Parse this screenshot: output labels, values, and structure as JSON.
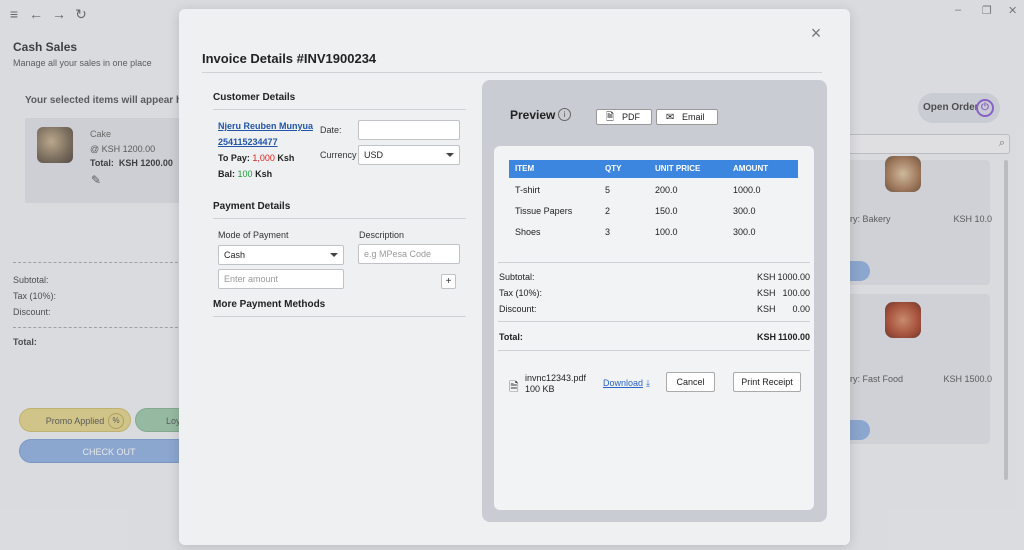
{
  "background": {
    "page_title": "Cash Sales",
    "page_subtitle": "Manage all your sales in one place",
    "selected_hint": "Your selected items will appear her",
    "cart_item": {
      "name": "Cake",
      "price": "@ KSH 1200.00",
      "total_label": "Total:",
      "total_value": "KSH 1200.00"
    },
    "summary": {
      "subtotal": "Subtotal:",
      "tax": "Tax (10%):",
      "discount": "Discount:",
      "total": "Total:"
    },
    "promo_label": "Promo Applied",
    "loyalty_label": "Loy",
    "checkout_label": "CHECK OUT",
    "open_order_label": "Open Order",
    "products": [
      {
        "category": "ory: Bakery",
        "price": "KSH 10.0",
        "partial": "s",
        "partial_price": "0"
      },
      {
        "category": "ory: Fast Food",
        "price": "KSH 1500.0"
      }
    ]
  },
  "modal": {
    "title": "Invoice Details #INV1900234",
    "customer_section": "Customer Details",
    "customer": {
      "name": "Njeru Reuben Munyua",
      "phone": "254115234477",
      "to_pay_label": "To Pay:",
      "to_pay_value": "1,000",
      "to_pay_currency": "Ksh",
      "bal_label": "Bal:",
      "bal_value": "100",
      "bal_currency": "Ksh"
    },
    "date_label": "Date:",
    "date_value": "",
    "currency_label": "Currency",
    "currency_value": "USD",
    "payment_section": "Payment Details",
    "mode_label": "Mode of Payment",
    "mode_value": "Cash",
    "description_label": "Description",
    "description_placeholder": "e.g MPesa Code",
    "amount_placeholder": "Enter amount",
    "add_label": "+",
    "more_methods": "More Payment Methods"
  },
  "preview": {
    "title": "Preview",
    "pdf_label": "PDF",
    "email_label": "Email",
    "table": {
      "headers": [
        "ITEM",
        "QTY",
        "UNIT PRICE",
        "AMOUNT"
      ],
      "rows": [
        [
          "T-shirt",
          "5",
          "200.0",
          "1000.0"
        ],
        [
          "Tissue Papers",
          "2",
          "150.0",
          "300.0"
        ],
        [
          "Shoes",
          "3",
          "100.0",
          "300.0"
        ]
      ]
    },
    "summary": {
      "subtotal_label": "Subtotal:",
      "subtotal_cur": "KSH",
      "subtotal_value": "1000.00",
      "tax_label": "Tax (10%):",
      "tax_cur": "KSH",
      "tax_value": "100.00",
      "discount_label": "Discount:",
      "discount_cur": "KSH",
      "discount_value": "0.00",
      "total_label": "Total:",
      "total_cur": "KSH",
      "total_value": "1100.00"
    },
    "file": {
      "name": "invnc12343.pdf",
      "size": "100 KB"
    },
    "download_label": "Download",
    "cancel_label": "Cancel",
    "print_label": "Print Receipt"
  },
  "colors": {
    "accent_blue": "#3d86e0",
    "to_pay_red": "#e02020",
    "balance_green": "#1f9a3a",
    "link_blue": "#2255aa"
  }
}
